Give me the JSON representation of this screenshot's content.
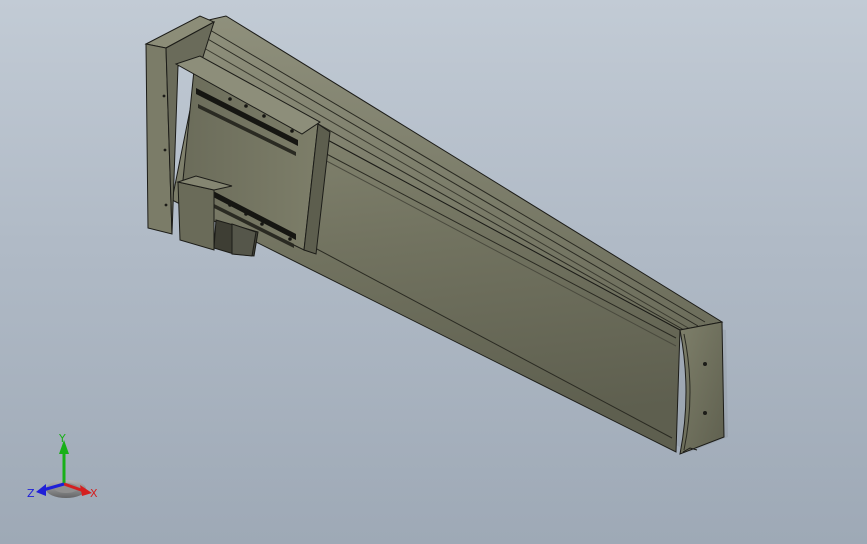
{
  "viewport": {
    "background_top": "#c2cbd5",
    "background_bottom": "#9ea9b6"
  },
  "model": {
    "body_color": "#6f705d",
    "edge_color": "#1c1c18"
  },
  "triad": {
    "x_label": "X",
    "y_label": "Y",
    "z_label": "Z",
    "x_color": "#d42020",
    "y_color": "#18b018",
    "z_color": "#2020d8"
  }
}
